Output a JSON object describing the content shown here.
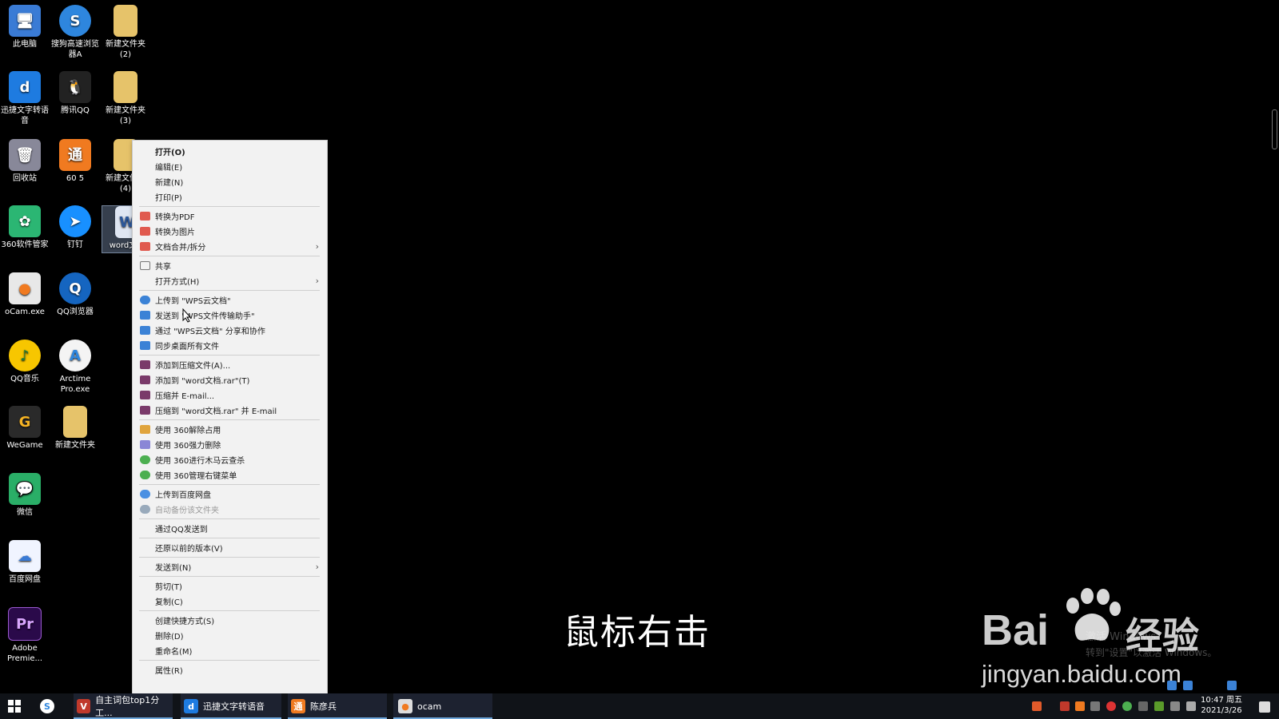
{
  "desktop": {
    "icons": [
      {
        "label": "此电脑",
        "color": "#3a7bd5",
        "glyph": "🖥"
      },
      {
        "label": "搜狗高速浏览器A",
        "color": "#2e86de",
        "glyph": "S"
      },
      {
        "label": "新建文件夹 (2)",
        "color": "#e6c36a",
        "glyph": ""
      },
      {
        "label": "迅捷文字转语音",
        "color": "#1e7be0",
        "glyph": "d"
      },
      {
        "label": "腾讯QQ",
        "color": "#222",
        "glyph": "🐧"
      },
      {
        "label": "新建文件夹 (3)",
        "color": "#e6c36a",
        "glyph": ""
      },
      {
        "label": "回收站",
        "color": "#889",
        "glyph": "🗑"
      },
      {
        "label": "60 5",
        "color": "#f07a20",
        "glyph": "通"
      },
      {
        "label": "新建文件夹 (4)",
        "color": "#e6c36a",
        "glyph": ""
      },
      {
        "label": "360软件管家",
        "color": "#2bb673",
        "glyph": "✿"
      },
      {
        "label": "钉钉",
        "color": "#1890ff",
        "glyph": "➤"
      },
      {
        "label": "word文档",
        "color": "#dfe6f2",
        "glyph": "W"
      },
      {
        "label": "oCam.exe",
        "color": "#e8e8e8",
        "glyph": "●"
      },
      {
        "label": "QQ浏览器",
        "color": "#1565c0",
        "glyph": "Q"
      },
      {
        "label": "QQ音乐",
        "color": "#f7c600",
        "glyph": "♪"
      },
      {
        "label": "Arctime Pro.exe",
        "color": "#f4f4f4",
        "glyph": "A"
      },
      {
        "label": "WeGame",
        "color": "#2a2a2a",
        "glyph": "G"
      },
      {
        "label": "新建文件夹",
        "color": "#e6c36a",
        "glyph": ""
      },
      {
        "label": "微信",
        "color": "#2aae67",
        "glyph": "💬"
      },
      {
        "label": "百度网盘",
        "color": "#f0f4ff",
        "glyph": "☁"
      },
      {
        "label": "Adobe Premie...",
        "color": "#2a0a4a",
        "glyph": "Pr"
      }
    ]
  },
  "context_menu": {
    "items": [
      {
        "label": "打开(O)",
        "bold": true
      },
      {
        "label": "编辑(E)"
      },
      {
        "label": "新建(N)"
      },
      {
        "label": "打印(P)"
      },
      {
        "label": "转换为PDF",
        "icon": "#e05a4f"
      },
      {
        "label": "转换为图片",
        "icon": "#e05a4f"
      },
      {
        "label": "文档合并/拆分",
        "icon": "#e05a4f",
        "submenu": true
      },
      {
        "label": "共享",
        "icon": "#777"
      },
      {
        "label": "打开方式(H)",
        "submenu": true
      },
      {
        "label": "上传到 \"WPS云文档\"",
        "icon": "#3b82d6"
      },
      {
        "label": "发送到 \"WPS文件传输助手\"",
        "icon": "#3b82d6"
      },
      {
        "label": "通过 \"WPS云文档\" 分享和协作",
        "icon": "#3b82d6"
      },
      {
        "label": "同步桌面所有文件",
        "icon": "#3b82d6"
      },
      {
        "label": "添加到压缩文件(A)...",
        "icon": "#7a3a6a"
      },
      {
        "label": "添加到 \"word文档.rar\"(T)",
        "icon": "#7a3a6a"
      },
      {
        "label": "压缩并 E-mail...",
        "icon": "#7a3a6a"
      },
      {
        "label": "压缩到 \"word文档.rar\" 并 E-mail",
        "icon": "#7a3a6a"
      },
      {
        "label": "使用 360解除占用",
        "icon": "#e0a43c"
      },
      {
        "label": "使用 360强力删除",
        "icon": "#8a86d6"
      },
      {
        "label": "使用 360进行木马云查杀",
        "icon": "#4caf50"
      },
      {
        "label": "使用 360管理右键菜单",
        "icon": "#4caf50"
      },
      {
        "label": "上传到百度网盘",
        "icon": "#4a90e2"
      },
      {
        "label": "自动备份该文件夹",
        "icon": "#9ab",
        "disabled": true
      },
      {
        "label": "通过QQ发送到"
      },
      {
        "label": "还原以前的版本(V)"
      },
      {
        "label": "发送到(N)",
        "submenu": true
      },
      {
        "label": "剪切(T)"
      },
      {
        "label": "复制(C)"
      },
      {
        "label": "创建快捷方式(S)"
      },
      {
        "label": "删除(D)"
      },
      {
        "label": "重命名(M)"
      },
      {
        "label": "属性(R)"
      }
    ]
  },
  "subtitle": "鼠标右击",
  "watermark": {
    "left": "Bai",
    "right": "经验",
    "url": "jingyan.baidu.com",
    "activate_line1": "激活 Windows",
    "activate_line2": "转到\"设置\"以激活 Windows。"
  },
  "taskbar": {
    "windows": [
      {
        "label": "自主词包top1分工...",
        "icon_color": "#c0392b",
        "glyph": "V"
      },
      {
        "label": "迅捷文字转语音",
        "icon_color": "#1e7be0",
        "glyph": "d"
      },
      {
        "label": "陈彦兵",
        "icon_color": "#f07a20",
        "glyph": "通"
      },
      {
        "label": "ocam",
        "icon_color": "#ddd",
        "glyph": "●"
      }
    ],
    "clock_time": "10:47 周五",
    "clock_date": "2021/3/26"
  }
}
